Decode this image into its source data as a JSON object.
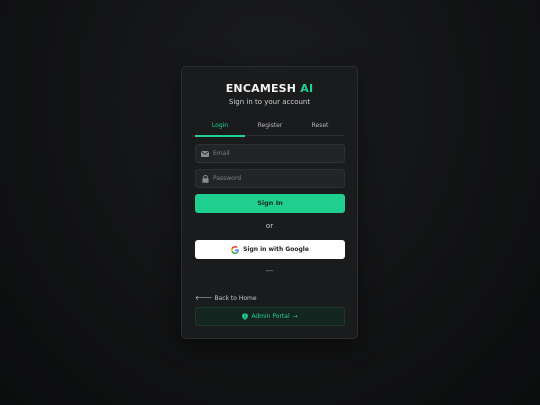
{
  "brand": {
    "name": "ENCAMESH",
    "accent": "AI"
  },
  "subtitle": "Sign in to your account",
  "tabs": [
    {
      "label": "Login",
      "active": true
    },
    {
      "label": "Register",
      "active": false
    },
    {
      "label": "Reset",
      "active": false
    }
  ],
  "form": {
    "email": {
      "placeholder": "Email",
      "value": "",
      "icon": "envelope-icon"
    },
    "password": {
      "placeholder": "Password",
      "value": "",
      "icon": "lock-icon"
    },
    "submit_label": "Sign In"
  },
  "divider_text": "or",
  "google": {
    "label": "Sign in with Google",
    "icon": "google-icon"
  },
  "separator": "—",
  "back_link": {
    "arrow": "🡐",
    "label": "Back to Home"
  },
  "admin": {
    "icon": "shield-icon",
    "label": "Admin Portal",
    "arrow": "→"
  },
  "colors": {
    "accent": "#1fd494",
    "background": "#121314",
    "card": "#1a1b1d",
    "input": "#232427",
    "primary_button": "#1fcf90",
    "admin_button": "#14251f"
  }
}
